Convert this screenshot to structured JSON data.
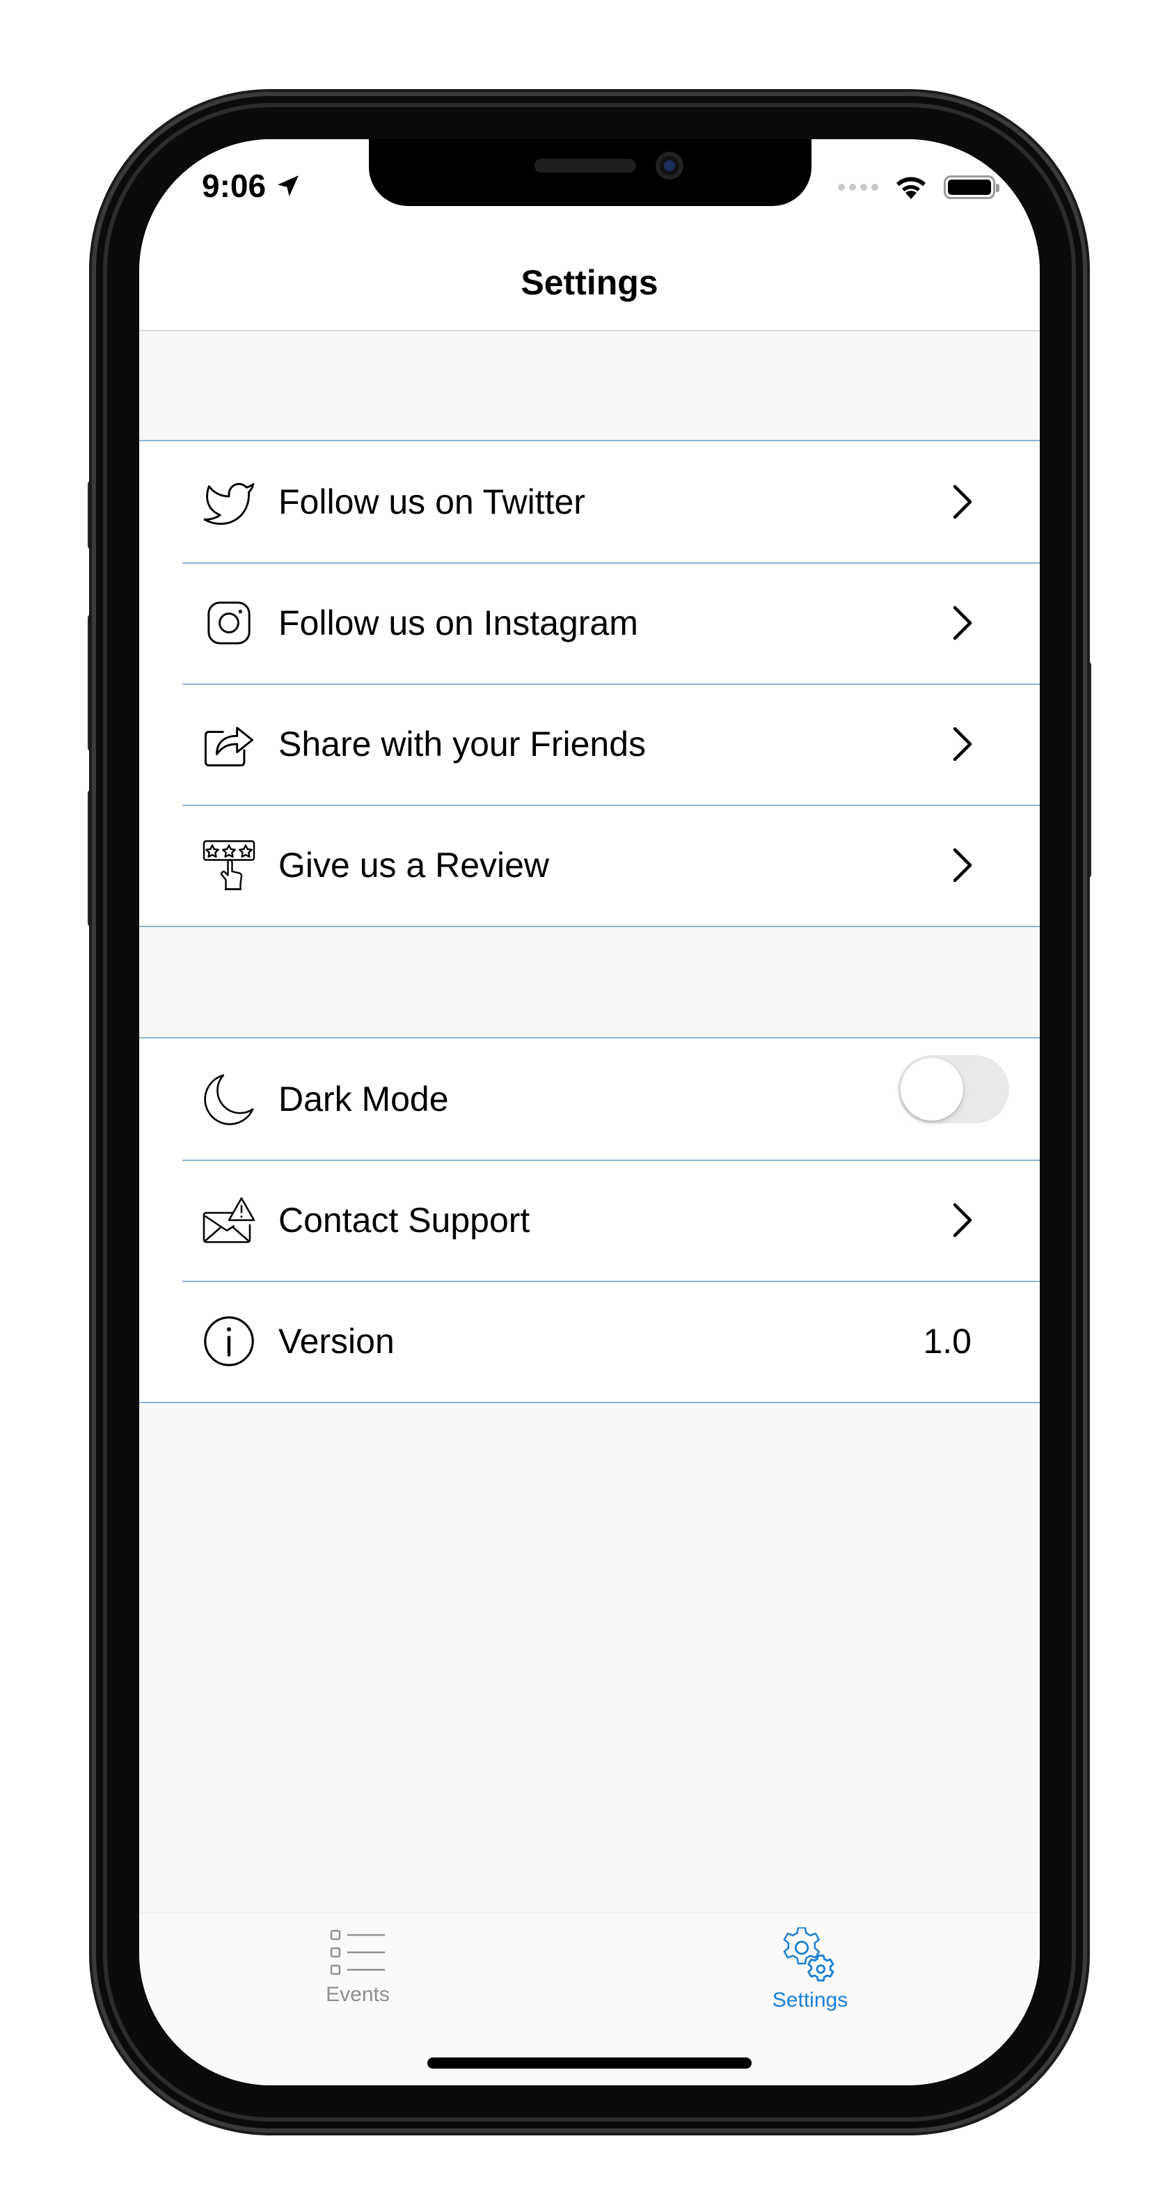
{
  "status_bar": {
    "time": "9:06",
    "icons": [
      "location-arrow-icon",
      "cellular-signal-icon",
      "wifi-icon",
      "battery-icon"
    ]
  },
  "nav": {
    "title": "Settings"
  },
  "groups": {
    "social": {
      "items": [
        {
          "label": "Follow us on Twitter",
          "icon": "twitter-bird-icon"
        },
        {
          "label": "Follow us on Instagram",
          "icon": "instagram-icon"
        },
        {
          "label": "Share with your Friends",
          "icon": "share-icon"
        },
        {
          "label": "Give us a Review",
          "icon": "review-stars-icon"
        }
      ]
    },
    "app": {
      "items": [
        {
          "label": "Dark Mode",
          "icon": "moon-icon",
          "toggle_on": false
        },
        {
          "label": "Contact Support",
          "icon": "mail-warning-icon"
        },
        {
          "label": "Version",
          "icon": "info-icon",
          "value": "1.0"
        }
      ]
    }
  },
  "tab_bar": {
    "tabs": [
      {
        "label": "Events",
        "icon": "list-icon",
        "active": false
      },
      {
        "label": "Settings",
        "icon": "gear-icon",
        "active": true
      }
    ]
  },
  "colors": {
    "accent": "#1a7fd6",
    "separator": "#8cb2d6",
    "inactive_tab": "#8e8e93",
    "background": "#f7f7f7"
  }
}
